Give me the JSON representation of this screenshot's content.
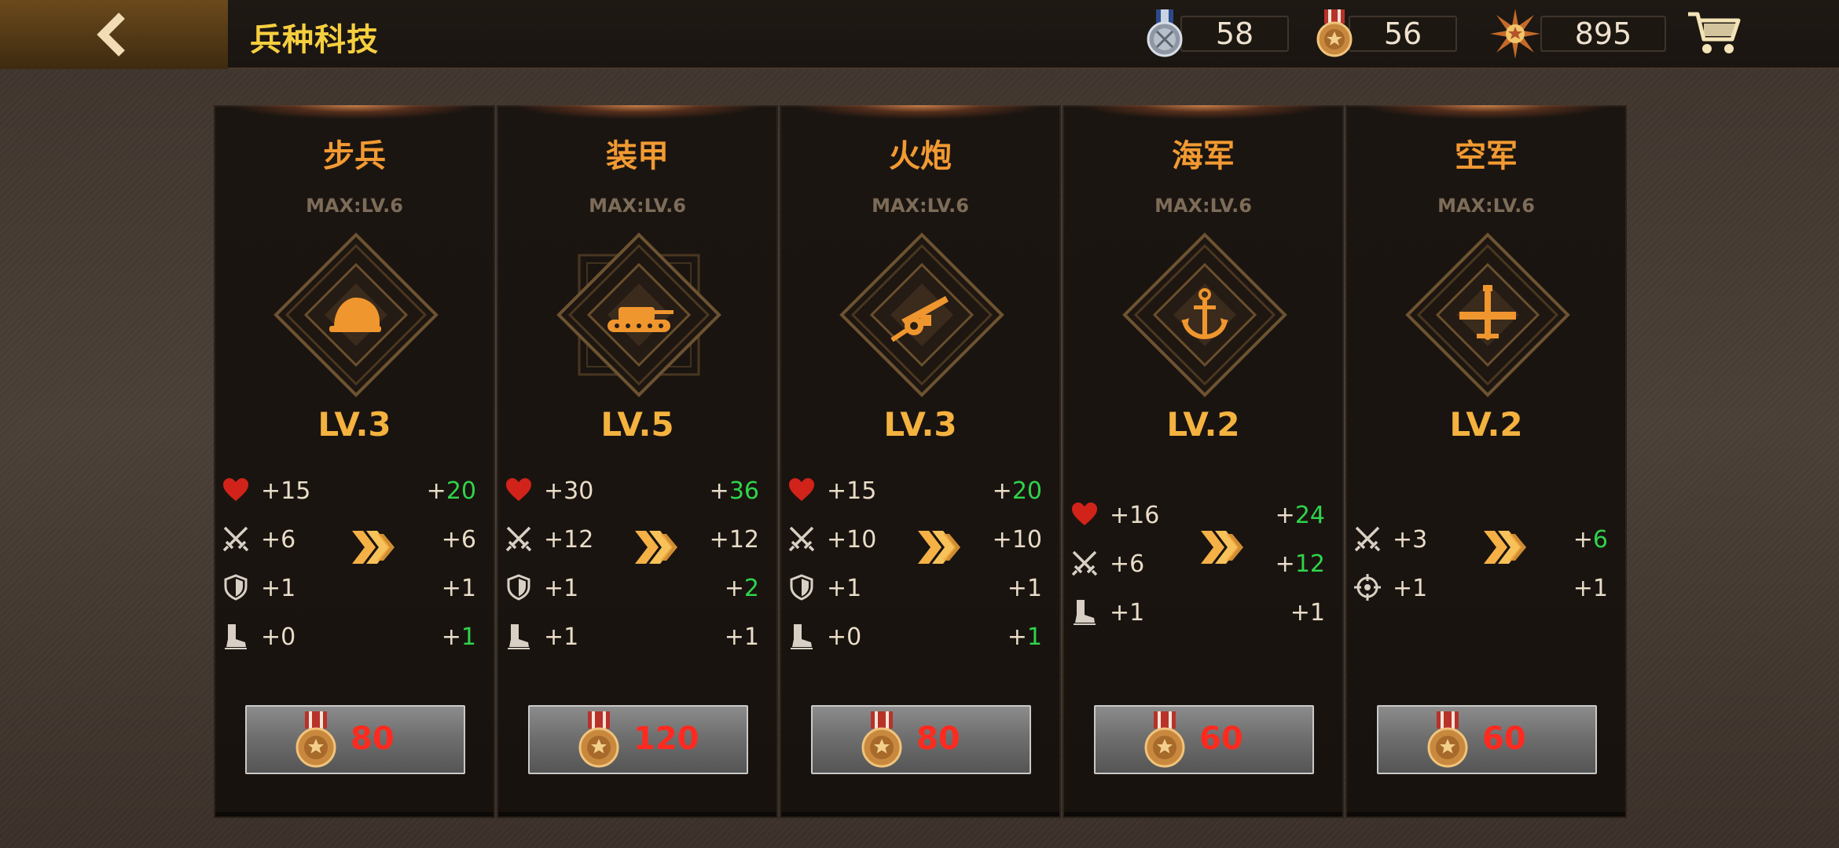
{
  "header": {
    "title": "兵种科技",
    "resources": [
      {
        "icon": "silver-medal-icon",
        "value": "58"
      },
      {
        "icon": "bronze-medal-icon",
        "value": "56"
      },
      {
        "icon": "star-badge-icon",
        "value": "895"
      }
    ]
  },
  "colors": {
    "title": "#f6cf3f",
    "branch_name": "#f29a32",
    "level": "#f4b23f",
    "increase": "#2fd44a",
    "cost": "#ff2a1f"
  },
  "branches": [
    {
      "name": "步兵",
      "max": "MAX:LV.6",
      "icon": "helmet-icon",
      "level": "LV.3",
      "stats": [
        {
          "icon": "heart-icon",
          "cur": "15",
          "next": "20",
          "up": true
        },
        {
          "icon": "swords-icon",
          "cur": "6",
          "next": "6",
          "up": false
        },
        {
          "icon": "shield-icon",
          "cur": "1",
          "next": "1",
          "up": false
        },
        {
          "icon": "boot-icon",
          "cur": "0",
          "next": "1",
          "up": true
        }
      ],
      "cost": "80"
    },
    {
      "name": "装甲",
      "max": "MAX:LV.6",
      "icon": "tank-icon",
      "level": "LV.5",
      "stats": [
        {
          "icon": "heart-icon",
          "cur": "30",
          "next": "36",
          "up": true
        },
        {
          "icon": "swords-icon",
          "cur": "12",
          "next": "12",
          "up": false
        },
        {
          "icon": "shield-icon",
          "cur": "1",
          "next": "2",
          "up": true
        },
        {
          "icon": "boot-icon",
          "cur": "1",
          "next": "1",
          "up": false
        }
      ],
      "cost": "120"
    },
    {
      "name": "火炮",
      "max": "MAX:LV.6",
      "icon": "cannon-icon",
      "level": "LV.3",
      "stats": [
        {
          "icon": "heart-icon",
          "cur": "15",
          "next": "20",
          "up": true
        },
        {
          "icon": "swords-icon",
          "cur": "10",
          "next": "10",
          "up": false
        },
        {
          "icon": "shield-icon",
          "cur": "1",
          "next": "1",
          "up": false
        },
        {
          "icon": "boot-icon",
          "cur": "0",
          "next": "1",
          "up": true
        }
      ],
      "cost": "80"
    },
    {
      "name": "海军",
      "max": "MAX:LV.6",
      "icon": "anchor-icon",
      "level": "LV.2",
      "stats": [
        {
          "icon": "heart-icon",
          "cur": "16",
          "next": "24",
          "up": true
        },
        {
          "icon": "swords-icon",
          "cur": "6",
          "next": "12",
          "up": true
        },
        {
          "icon": "boot-icon",
          "cur": "1",
          "next": "1",
          "up": false
        }
      ],
      "cost": "60"
    },
    {
      "name": "空军",
      "max": "MAX:LV.6",
      "icon": "plane-icon",
      "level": "LV.2",
      "stats": [
        {
          "icon": "swords-icon",
          "cur": "3",
          "next": "6",
          "up": true
        },
        {
          "icon": "crosshair-icon",
          "cur": "1",
          "next": "1",
          "up": false
        }
      ],
      "cost": "60"
    }
  ]
}
